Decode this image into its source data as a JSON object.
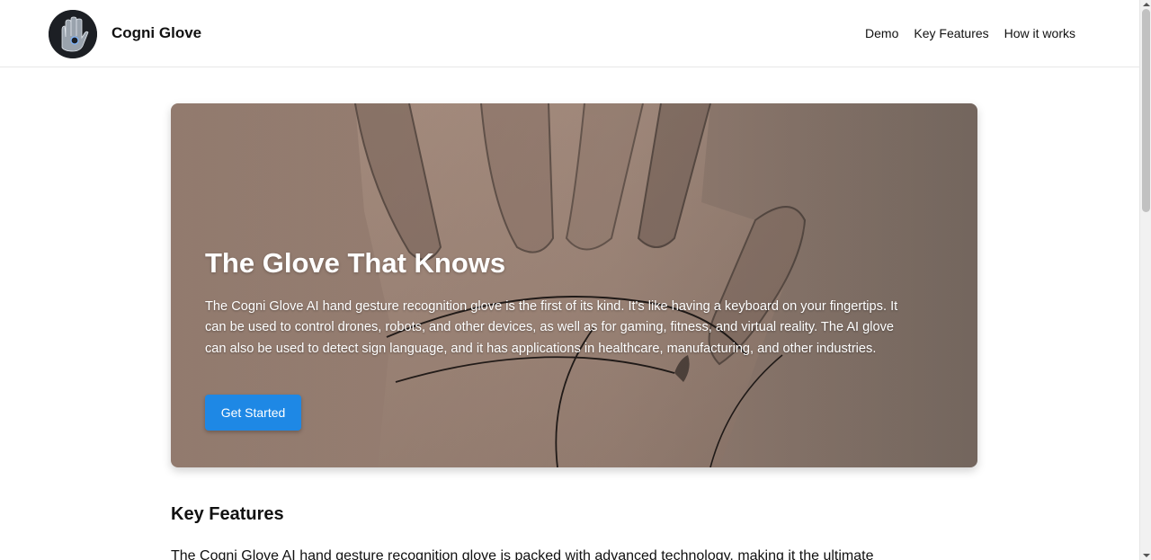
{
  "header": {
    "logo_icon": "glove-logo-icon",
    "brand": "Cogni Glove",
    "nav": [
      "Demo",
      "Key Features",
      "How it works"
    ]
  },
  "hero": {
    "background": "palm-hand-photo",
    "title": "The Glove That Knows",
    "description": "The Cogni Glove AI hand gesture recognition glove is the first of its kind. It's like having a keyboard on your fingertips. It can be used to control drones, robots, and other devices, as well as for gaming, fitness, and virtual reality. The AI glove can also be used to detect sign language, and it has applications in healthcare, manufacturing, and other industries.",
    "cta_label": "Get Started"
  },
  "key_features": {
    "title": "Key Features",
    "intro": "The Cogni Glove AI hand gesture recognition glove is packed with advanced technology, making it the ultimate"
  },
  "colors": {
    "accent": "#1e88e5",
    "hero_tone": "#9b8479"
  }
}
